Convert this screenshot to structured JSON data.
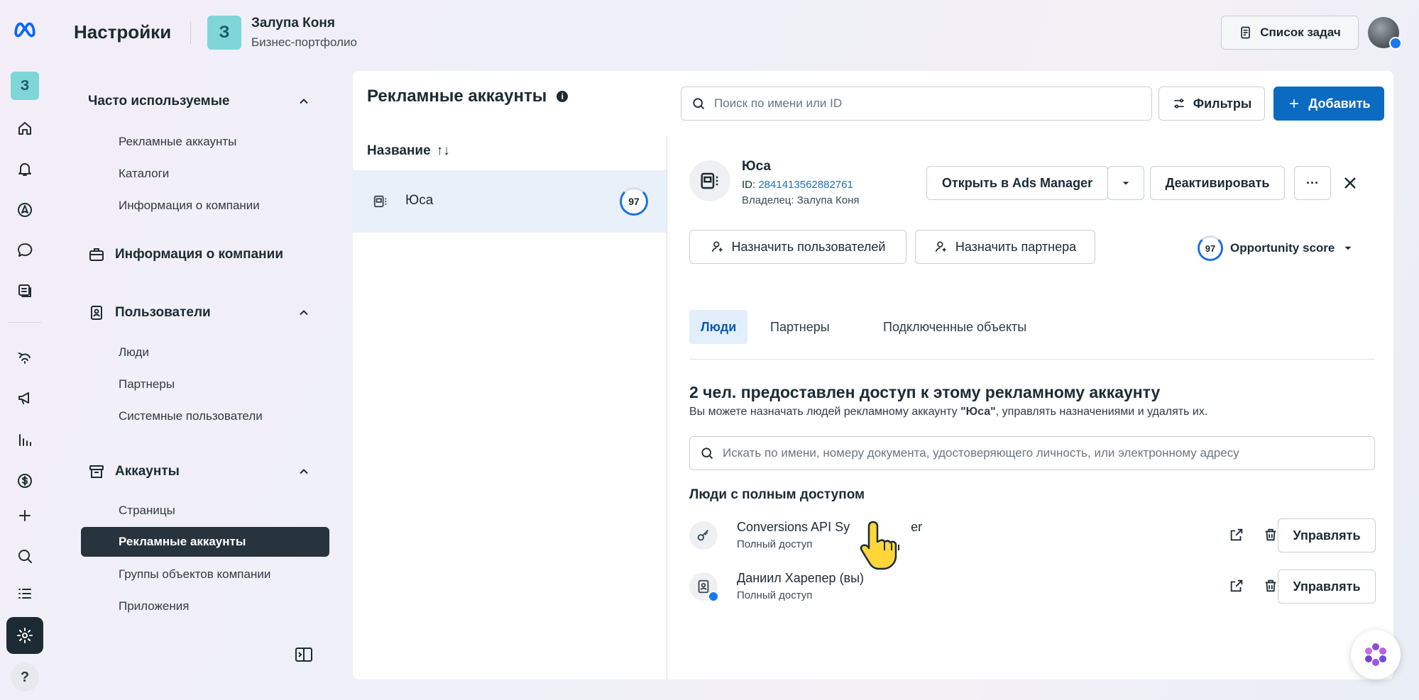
{
  "header": {
    "title": "Настройки",
    "portfolio_initial": "З",
    "portfolio_name": "Залупа Коня",
    "portfolio_sub": "Бизнес-портфолио",
    "tasks_label": "Список задач"
  },
  "rail": {
    "initial": "З",
    "help": "?"
  },
  "sidebar": {
    "frequent": {
      "title": "Часто используемые",
      "items": [
        "Рекламные аккаунты",
        "Каталоги",
        "Информация о компании"
      ]
    },
    "company": {
      "title": "Информация о компании"
    },
    "users": {
      "title": "Пользователи",
      "items": [
        "Люди",
        "Партнеры",
        "Системные пользователи"
      ]
    },
    "accounts": {
      "title": "Аккаунты",
      "items": [
        "Страницы",
        "Рекламные аккаунты",
        "Группы объектов компании",
        "Приложения"
      ],
      "selected_index": 1
    }
  },
  "list": {
    "title": "Рекламные аккаунты",
    "info_icon": "i",
    "column": "Название",
    "sort_icon": "↑↓",
    "rows": [
      {
        "name": "Юса",
        "score": "97"
      }
    ]
  },
  "toolbar": {
    "search_placeholder": "Поиск по имени или ID",
    "filters_label": "Фильтры",
    "add_label": "Добавить"
  },
  "detail": {
    "name": "Юса",
    "id_prefix": "ID:",
    "id_value": "2841413562882761",
    "owner": "Владелец: Залупа Коня",
    "open_ads_manager": "Открыть в Ads Manager",
    "deactivate": "Деактивировать",
    "more": "···",
    "assign_users": "Назначить пользователей",
    "assign_partner": "Назначить партнера",
    "score": "97",
    "opportunity_label": "Opportunity score"
  },
  "tabs": [
    "Люди",
    "Партнеры",
    "Подключенные объекты"
  ],
  "people": {
    "title": "2 чел. предоставлен доступ к этому рекламному аккаунту",
    "desc_pre": "Вы можете назначать людей рекламному аккаунту ",
    "desc_name": "\"Юса\"",
    "desc_post": ", управлять назначениями и удалять их.",
    "search_placeholder": "Искать по имени, номеру документа, удостоверяющего личность, или электронному адресу",
    "full_access_title": "Люди с полным доступом",
    "members": [
      {
        "name": "Conversions API Sy",
        "name_tail": "er",
        "access": "Полный доступ",
        "manage": "Управлять"
      },
      {
        "name": "Даниил Харепер (вы)",
        "access": "Полный доступ",
        "manage": "Управлять"
      }
    ]
  },
  "colors": {
    "primary": "#0b6bc2",
    "dark": "#1c2b33",
    "selected_row": "#e8f0fa",
    "teal_avatar": "#7fd6d9"
  }
}
